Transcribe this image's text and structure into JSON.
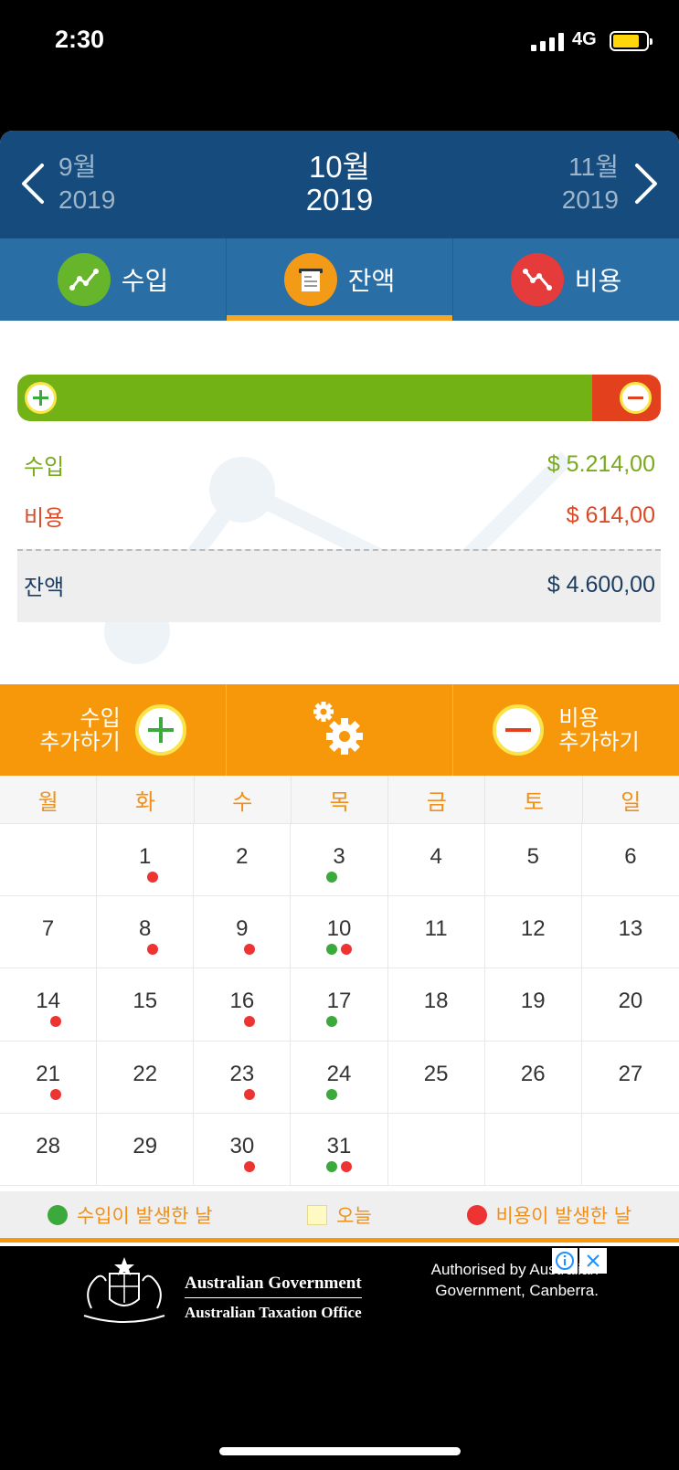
{
  "status": {
    "time": "2:30",
    "network": "4G"
  },
  "header": {
    "prev": {
      "month": "9월",
      "year": "2019"
    },
    "current": {
      "month": "10월",
      "year": "2019"
    },
    "next": {
      "month": "11월",
      "year": "2019"
    }
  },
  "tabs": [
    {
      "label": "수입",
      "icon": "income-trend-icon"
    },
    {
      "label": "잔액",
      "icon": "balance-register-icon",
      "active": true
    },
    {
      "label": "비용",
      "icon": "expense-trend-icon"
    }
  ],
  "summary": {
    "income_label": "수입",
    "income_value": "$ 5.214,00",
    "expense_label": "비용",
    "expense_value": "$ 614,00",
    "balance_label": "잔액",
    "balance_value": "$ 4.600,00",
    "income_share": 0.894
  },
  "actions": {
    "add_income_line1": "수입",
    "add_income_line2": "추가하기",
    "add_expense_line1": "비용",
    "add_expense_line2": "추가하기"
  },
  "calendar": {
    "weekdays": [
      "월",
      "화",
      "수",
      "목",
      "금",
      "토",
      "일"
    ],
    "days": [
      {
        "n": "",
        "g": false,
        "r": false
      },
      {
        "n": "1",
        "g": false,
        "r": true
      },
      {
        "n": "2",
        "g": false,
        "r": false
      },
      {
        "n": "3",
        "g": true,
        "r": false
      },
      {
        "n": "4",
        "g": false,
        "r": false
      },
      {
        "n": "5",
        "g": false,
        "r": false
      },
      {
        "n": "6",
        "g": false,
        "r": false
      },
      {
        "n": "7",
        "g": false,
        "r": false
      },
      {
        "n": "8",
        "g": false,
        "r": true
      },
      {
        "n": "9",
        "g": false,
        "r": true
      },
      {
        "n": "10",
        "g": true,
        "r": true
      },
      {
        "n": "11",
        "g": false,
        "r": false
      },
      {
        "n": "12",
        "g": false,
        "r": false
      },
      {
        "n": "13",
        "g": false,
        "r": false
      },
      {
        "n": "14",
        "g": false,
        "r": true
      },
      {
        "n": "15",
        "g": false,
        "r": false
      },
      {
        "n": "16",
        "g": false,
        "r": true
      },
      {
        "n": "17",
        "g": true,
        "r": false
      },
      {
        "n": "18",
        "g": false,
        "r": false
      },
      {
        "n": "19",
        "g": false,
        "r": false
      },
      {
        "n": "20",
        "g": false,
        "r": false
      },
      {
        "n": "21",
        "g": false,
        "r": true
      },
      {
        "n": "22",
        "g": false,
        "r": false
      },
      {
        "n": "23",
        "g": false,
        "r": true
      },
      {
        "n": "24",
        "g": true,
        "r": false
      },
      {
        "n": "25",
        "g": false,
        "r": false
      },
      {
        "n": "26",
        "g": false,
        "r": false
      },
      {
        "n": "27",
        "g": false,
        "r": false
      },
      {
        "n": "28",
        "g": false,
        "r": false
      },
      {
        "n": "29",
        "g": false,
        "r": false
      },
      {
        "n": "30",
        "g": false,
        "r": true
      },
      {
        "n": "31",
        "g": true,
        "r": true
      },
      {
        "n": "",
        "g": false,
        "r": false
      },
      {
        "n": "",
        "g": false,
        "r": false
      },
      {
        "n": "",
        "g": false,
        "r": false
      }
    ]
  },
  "legend": {
    "income_day": "수입이 발생한 날",
    "today": "오늘",
    "expense_day": "비용이 발생한 날"
  },
  "ad": {
    "line1": "Australian Government",
    "line2": "Australian Taxation Office",
    "note": "Authorised by Australian Government, Canberra."
  },
  "colors": {
    "header": "#164c7d",
    "tabs": "#2a6ea6",
    "accent": "#f7980b",
    "income": "#72b214",
    "expense": "#e3401e"
  }
}
